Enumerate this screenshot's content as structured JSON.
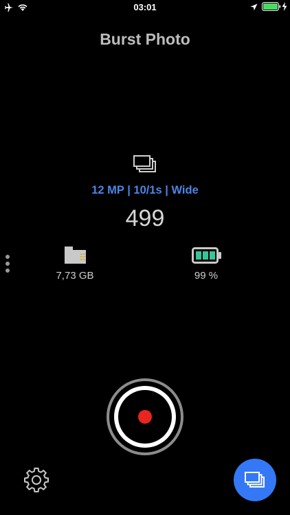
{
  "status_bar": {
    "time": "03:01",
    "icons": [
      "airplane-icon",
      "wifi-icon",
      "location-icon",
      "battery-icon",
      "charging-bolt-icon"
    ]
  },
  "header": {
    "title": "Burst Photo"
  },
  "capture_settings": {
    "icon": "burst-stack-icon",
    "summary": "12 MP | 10/1s | Wide"
  },
  "shots_remaining": "499",
  "storage": {
    "icon": "sd-card-icon",
    "value": "7,73 GB"
  },
  "battery": {
    "icon": "battery-icon",
    "value": "99 %"
  },
  "controls": {
    "menu_icon": "more-vertical-icon",
    "record_icon": "record-icon",
    "settings_icon": "gear-icon",
    "gallery_icon": "burst-stack-icon"
  },
  "colors": {
    "background": "#000000",
    "accent_blue": "#3478f6",
    "settings_text_blue": "#4a86e8",
    "record_red": "#e8251f",
    "status_battery_green": "#4cd964"
  }
}
